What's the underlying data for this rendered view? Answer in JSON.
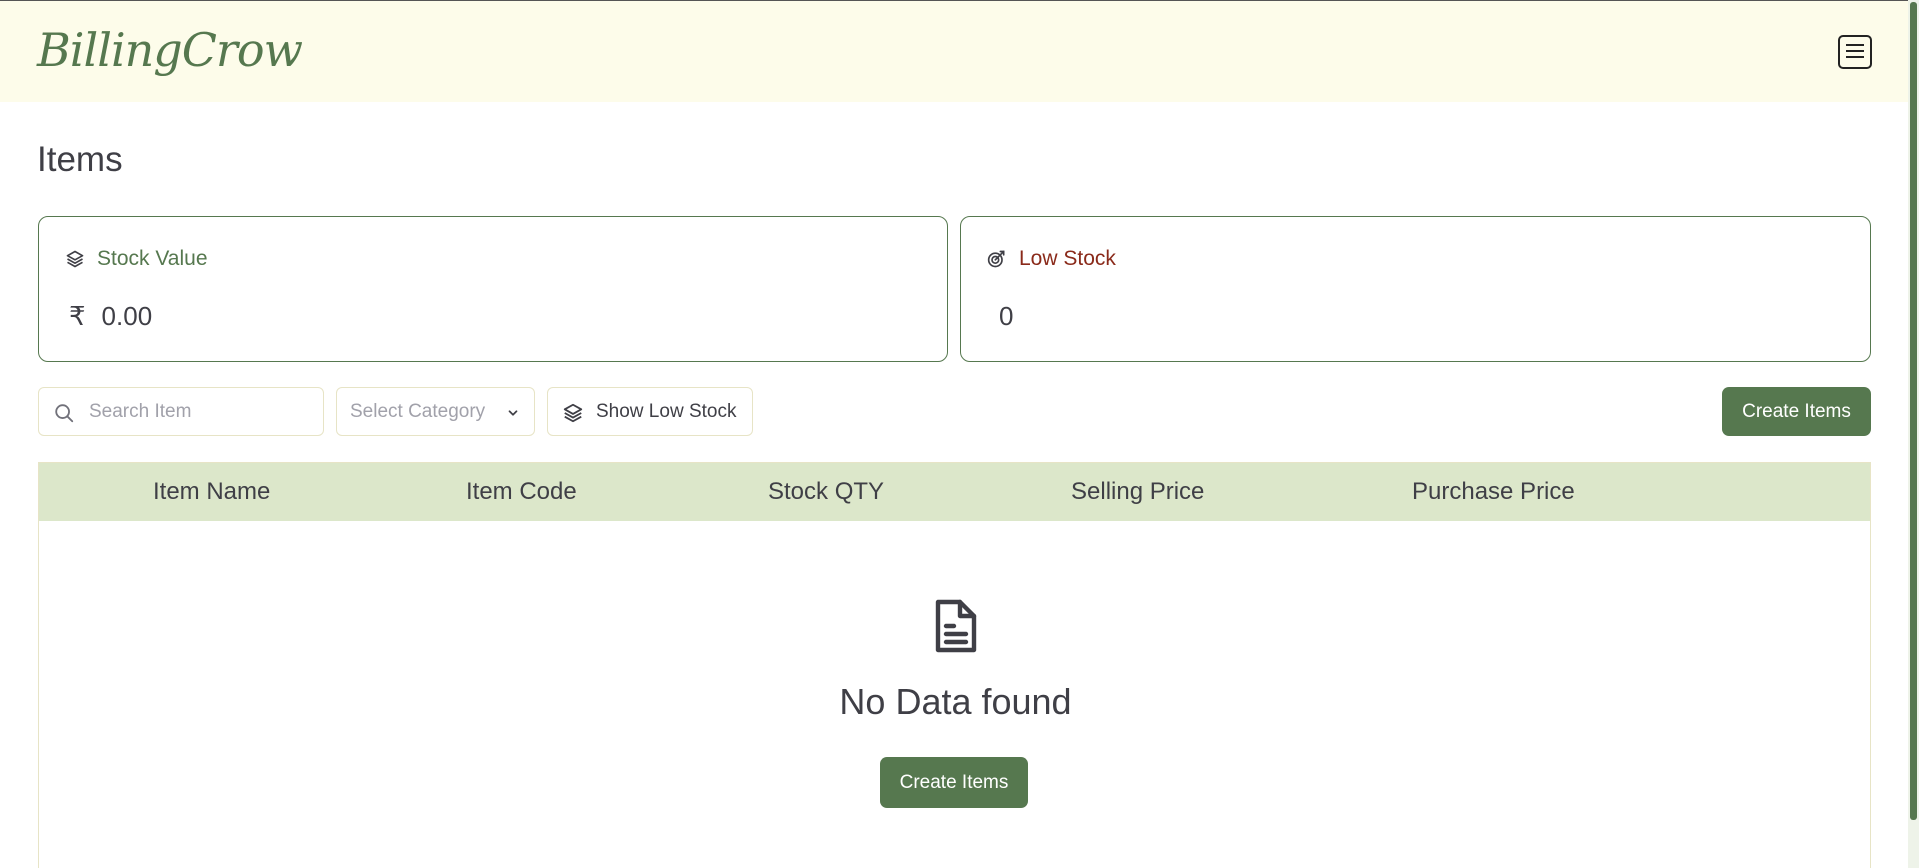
{
  "app": {
    "brand": "BillingCrow",
    "menu_icon": "hamburger-menu-icon"
  },
  "page": {
    "title": "Items"
  },
  "stats": {
    "stock_value": {
      "label": "Stock Value",
      "currency_symbol": "₹",
      "value": "0.00",
      "icon": "layers-icon",
      "label_color": "#56784f"
    },
    "low_stock": {
      "label": "Low Stock",
      "value": "0",
      "icon": "low-stock-icon",
      "label_color": "#8a2a1a"
    }
  },
  "toolbar": {
    "search_placeholder": "Search Item",
    "category_placeholder": "Select Category",
    "show_low_stock_label": "Show Low Stock",
    "create_label": "Create Items"
  },
  "table": {
    "columns": [
      "Item Name",
      "Item Code",
      "Stock QTY",
      "Selling Price",
      "Purchase Price"
    ],
    "rows": []
  },
  "empty_state": {
    "icon": "document-icon",
    "title": "No Data found",
    "button_label": "Create Items"
  },
  "colors": {
    "accent": "#56784f",
    "header_bg": "#fdfcea",
    "table_header_bg": "#dce7ca",
    "danger_text": "#8a2a1a"
  }
}
